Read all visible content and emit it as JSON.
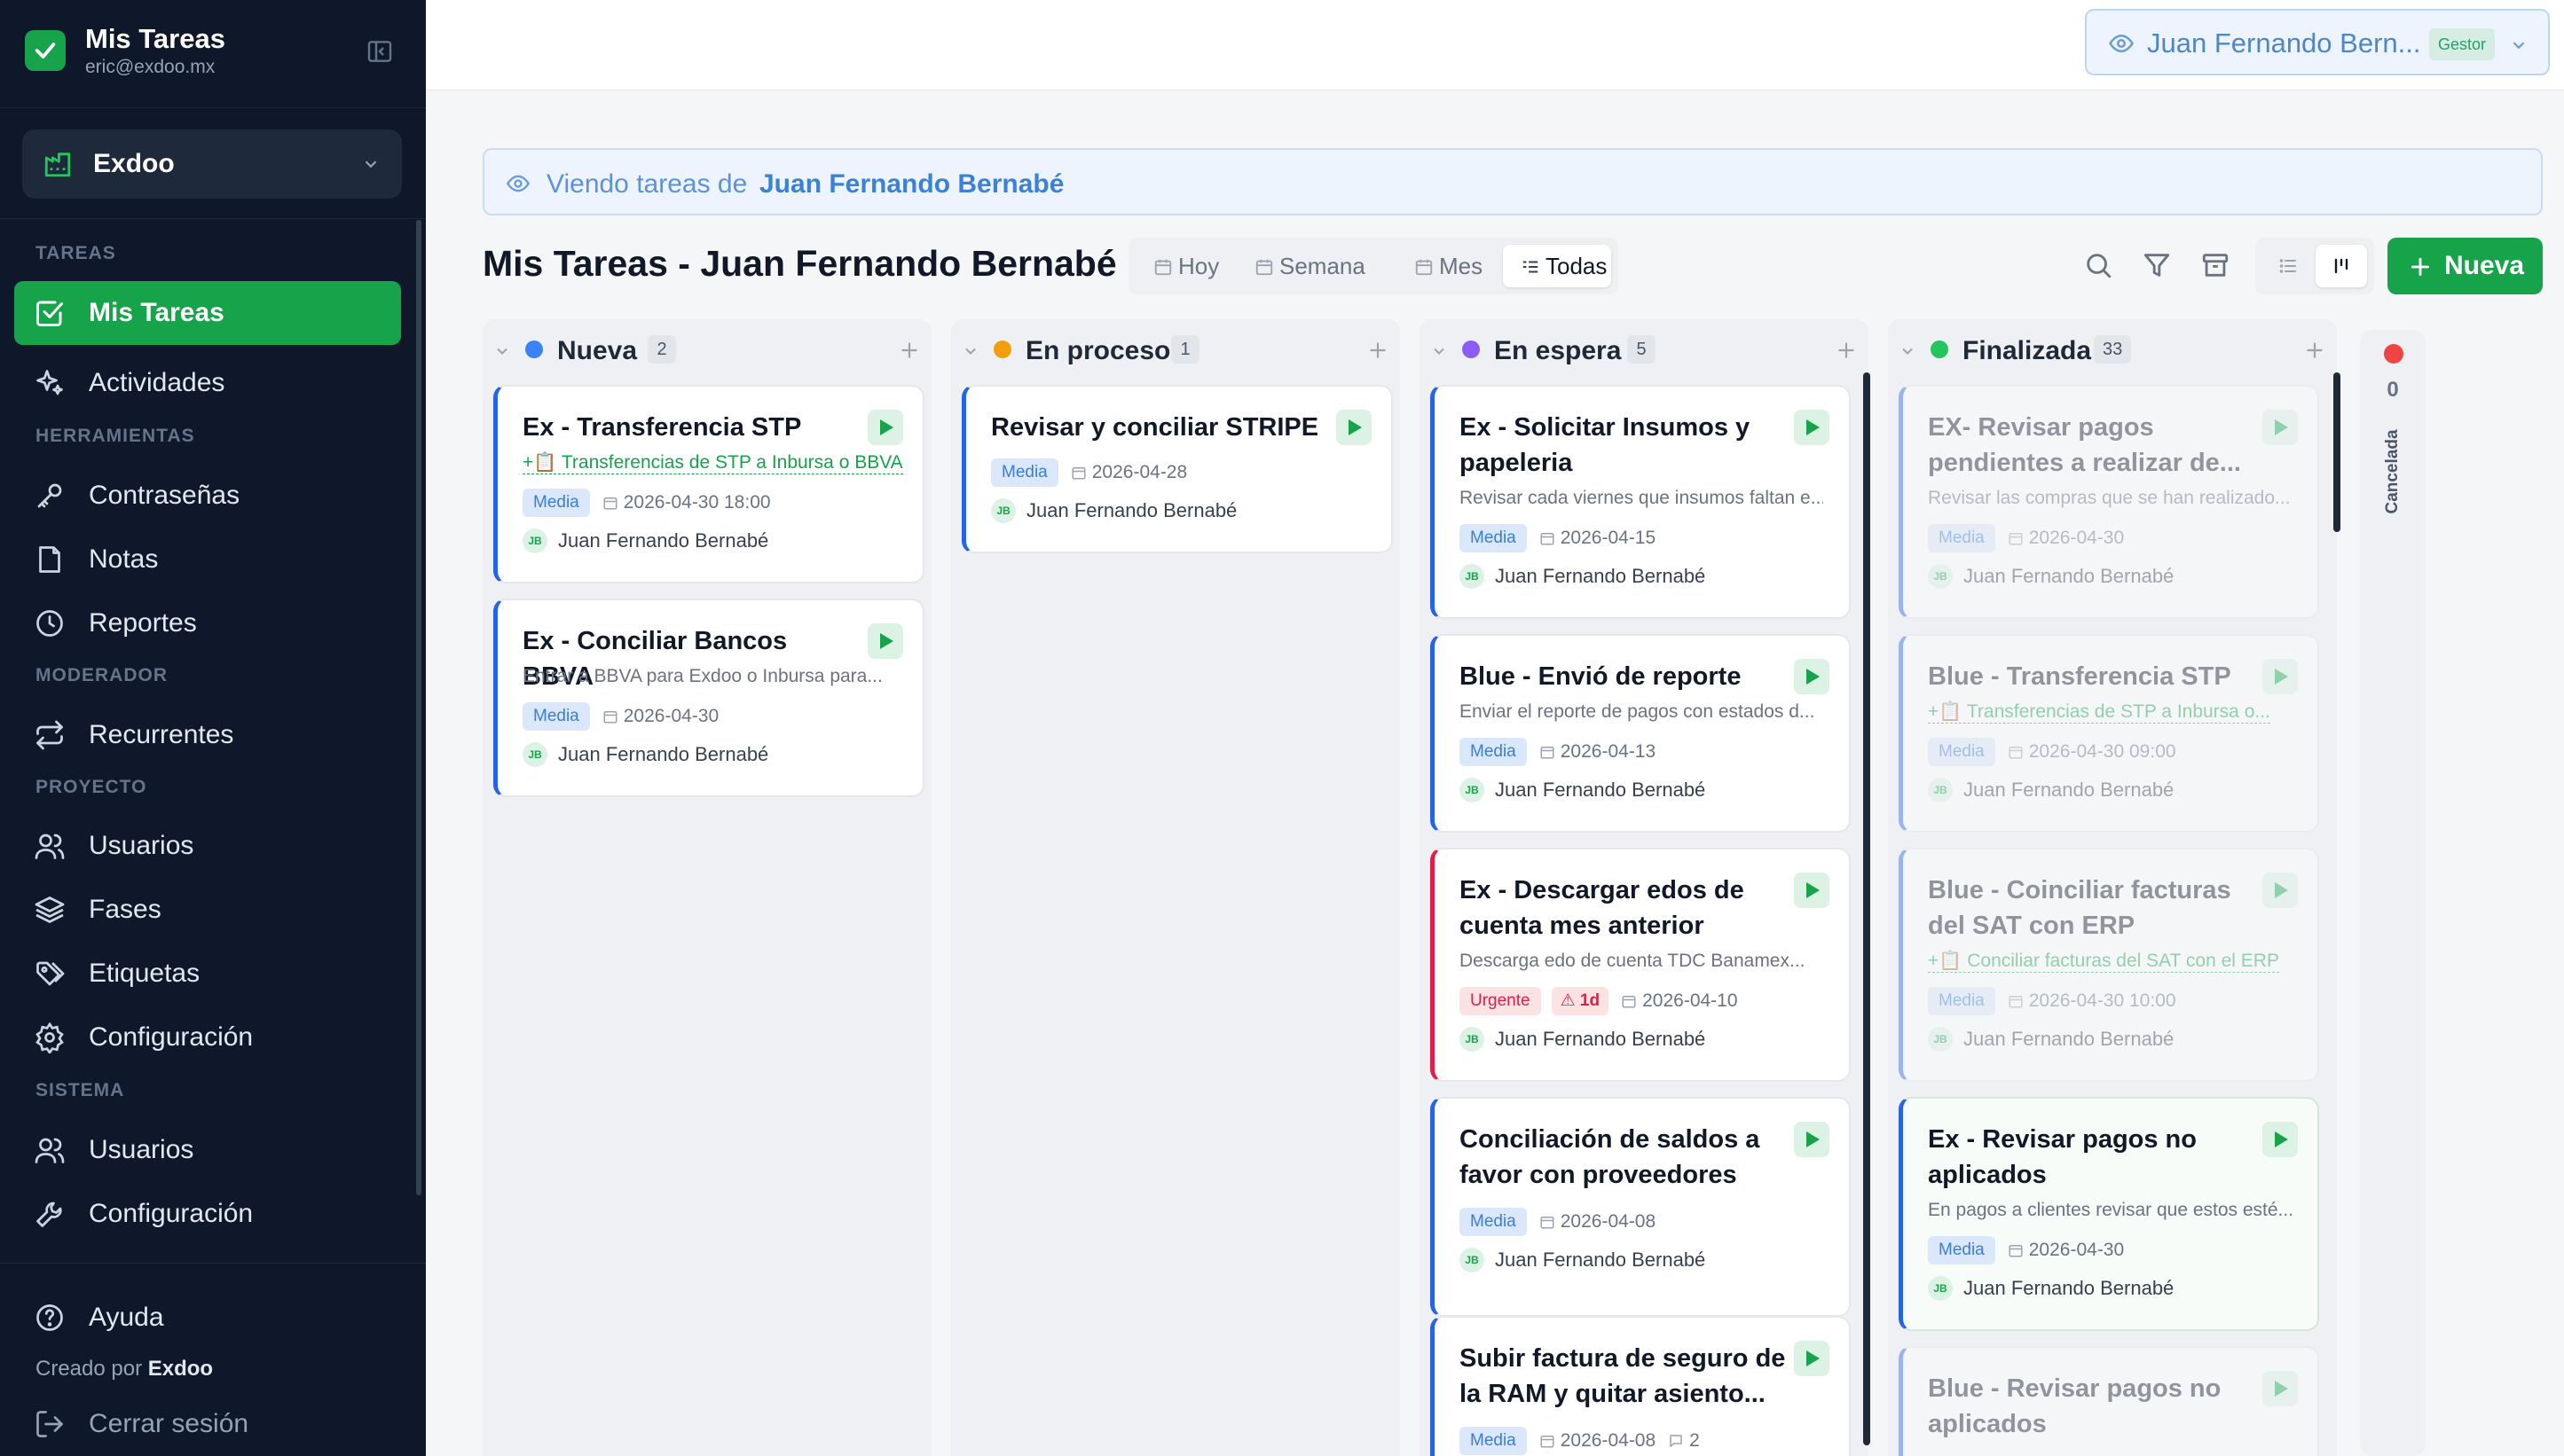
{
  "app": {
    "title": "Mis Tareas",
    "email": "eric@exdoo.mx"
  },
  "workspace": {
    "name": "Exdoo"
  },
  "sidebar": {
    "sections": [
      "TAREAS",
      "HERRAMIENTAS",
      "MODERADOR",
      "PROYECTO",
      "SISTEMA"
    ],
    "items": [
      {
        "label": "Mis Tareas",
        "icon": "checkbox-icon",
        "active": true
      },
      {
        "label": "Actividades",
        "icon": "sparkle-icon"
      },
      {
        "label": "Contraseñas",
        "icon": "key-icon"
      },
      {
        "label": "Notas",
        "icon": "note-icon"
      },
      {
        "label": "Reportes",
        "icon": "clock-icon"
      },
      {
        "label": "Recurrentes",
        "icon": "repeat-icon"
      },
      {
        "label": "Usuarios",
        "icon": "users-icon"
      },
      {
        "label": "Fases",
        "icon": "layers-icon"
      },
      {
        "label": "Etiquetas",
        "icon": "tags-icon"
      },
      {
        "label": "Configuración",
        "icon": "gear-icon"
      },
      {
        "label": "Usuarios",
        "icon": "users-icon"
      },
      {
        "label": "Configuración",
        "icon": "wrench-icon"
      }
    ],
    "help": "Ayuda",
    "created_by": "Creado por",
    "created_by_brand": "Exdoo",
    "logout": "Cerrar sesión"
  },
  "topbar": {
    "user": "Juan Fernando Bern...",
    "role_badge": "Gestor"
  },
  "viewing": {
    "prefix": "Viendo tareas de",
    "name": "Juan Fernando Bernabé"
  },
  "page_title": "Mis Tareas - Juan Fernando Bernabé",
  "tabs": [
    {
      "label": "Hoy"
    },
    {
      "label": "Semana"
    },
    {
      "label": "Mes"
    },
    {
      "label": "Todas",
      "active": true
    }
  ],
  "new_button": "Nueva",
  "columns": [
    {
      "name": "Nueva",
      "count": "2",
      "color": "#3b82f6",
      "cards": [
        {
          "title": "Ex - Transferencia STP",
          "link": "+📋 Transferencias de STP a Inbursa o BBVA",
          "priority": "Media",
          "date": "2026-04-30 18:00",
          "initials": "JB",
          "assignee": "Juan Fernando Bernabé"
        },
        {
          "title": "Ex - Conciliar Bancos BBVA",
          "desc": "Entrar a BBVA para Exdoo o Inbursa para...",
          "priority": "Media",
          "date": "2026-04-30",
          "initials": "JB",
          "assignee": "Juan Fernando Bernabé"
        }
      ]
    },
    {
      "name": "En proceso",
      "count": "1",
      "color": "#f59e0b",
      "cards": [
        {
          "title": "Revisar y conciliar STRIPE",
          "priority": "Media",
          "date": "2026-04-28",
          "initials": "JB",
          "assignee": "Juan Fernando Bernabé"
        }
      ]
    },
    {
      "name": "En espera",
      "count": "5",
      "color": "#8b5cf6",
      "cards": [
        {
          "title": "Ex - Solicitar Insumos y papeleria",
          "desc": "Revisar cada viernes que insumos faltan e...",
          "priority": "Media",
          "date": "2026-04-15",
          "initials": "JB",
          "assignee": "Juan Fernando Bernabé"
        },
        {
          "title": "Blue - Envió de reporte",
          "desc": "Enviar el reporte de pagos con estados d...",
          "priority": "Media",
          "date": "2026-04-13",
          "initials": "JB",
          "assignee": "Juan Fernando Bernabé"
        },
        {
          "title": "Ex - Descargar edos de cuenta mes anterior",
          "desc": "Descarga edo de cuenta TDC Banamex...",
          "priority": "Urgente",
          "overdue": "1d",
          "date": "2026-04-10",
          "initials": "JB",
          "assignee": "Juan Fernando Bernabé"
        },
        {
          "title": "Conciliación de saldos a favor con proveedores",
          "priority": "Media",
          "date": "2026-04-08",
          "initials": "JB",
          "assignee": "Juan Fernando Bernabé"
        },
        {
          "title": "Subir factura de seguro de la RAM y quitar asiento...",
          "priority": "Media",
          "date": "2026-04-08",
          "comments": "2"
        }
      ]
    },
    {
      "name": "Finalizada",
      "count": "33",
      "color": "#22c55e",
      "cards": [
        {
          "title": "EX- Revisar pagos pendientes a realizar de...",
          "desc": "Revisar las compras que se han realizado...",
          "priority": "Media",
          "date": "2026-04-30",
          "initials": "JB",
          "assignee": "Juan Fernando Bernabé"
        },
        {
          "title": "Blue - Transferencia STP",
          "link": "+📋 Transferencias de STP a Inbursa o...",
          "priority": "Media",
          "date": "2026-04-30 09:00",
          "initials": "JB",
          "assignee": "Juan Fernando Bernabé"
        },
        {
          "title": "Blue - Coinciliar facturas del SAT con ERP",
          "link": "+📋 Conciliar facturas del SAT con el ERP",
          "priority": "Media",
          "date": "2026-04-30 10:00",
          "initials": "JB",
          "assignee": "Juan Fernando Bernabé"
        },
        {
          "title": "Ex - Revisar pagos no aplicados",
          "desc": "En pagos a clientes revisar que estos esté...",
          "priority": "Media",
          "date": "2026-04-30",
          "initials": "JB",
          "assignee": "Juan Fernando Bernabé"
        },
        {
          "title": "Blue - Revisar pagos no aplicados"
        }
      ]
    }
  ],
  "cancelled": {
    "name": "Cancelada",
    "count": "0",
    "color": "#ef4444"
  }
}
